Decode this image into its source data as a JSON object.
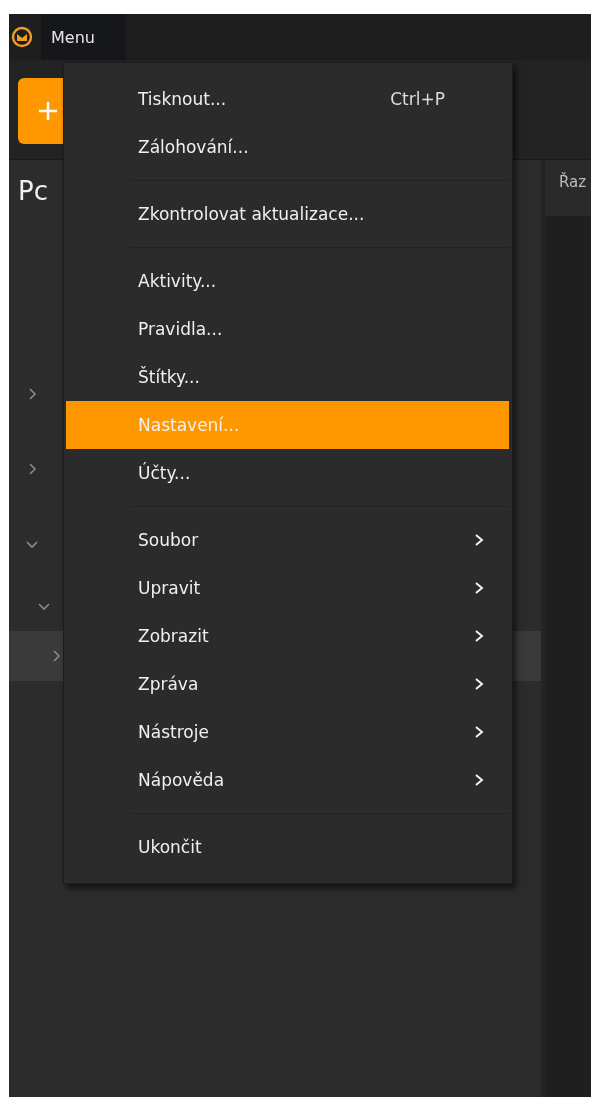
{
  "title_bar": {
    "menu_tab": "Menu"
  },
  "sidebar": {
    "title": "Pc",
    "tree": [
      {
        "expanded": false,
        "selected": false
      },
      {
        "expanded": false,
        "selected": false
      },
      {
        "expanded": true,
        "selected": false,
        "children": [
          {
            "expanded": true,
            "selected": false,
            "children": [
              {
                "expanded": false,
                "selected": true
              }
            ]
          }
        ]
      }
    ]
  },
  "message_pane": {
    "header": "Řaz"
  },
  "menu": {
    "groups": [
      [
        {
          "label": "Tisknout...",
          "shortcut": "Ctrl+P",
          "submenu": false,
          "selected": false
        },
        {
          "label": "Zálohování...",
          "submenu": false,
          "selected": false
        }
      ],
      [
        {
          "label": "Zkontrolovat aktualizace...",
          "submenu": false,
          "selected": false
        }
      ],
      [
        {
          "label": "Aktivity...",
          "submenu": false,
          "selected": false
        },
        {
          "label": "Pravidla...",
          "submenu": false,
          "selected": false
        },
        {
          "label": "Štítky...",
          "submenu": false,
          "selected": false
        },
        {
          "label": "Nastavení...",
          "submenu": false,
          "selected": true
        },
        {
          "label": "Účty...",
          "submenu": false,
          "selected": false
        }
      ],
      [
        {
          "label": "Soubor",
          "submenu": true,
          "selected": false
        },
        {
          "label": "Upravit",
          "submenu": true,
          "selected": false
        },
        {
          "label": "Zobrazit",
          "submenu": true,
          "selected": false
        },
        {
          "label": "Zpráva",
          "submenu": true,
          "selected": false
        },
        {
          "label": "Nástroje",
          "submenu": true,
          "selected": false
        },
        {
          "label": "Nápověda",
          "submenu": true,
          "selected": false
        }
      ],
      [
        {
          "label": "Ukončit",
          "submenu": false,
          "selected": false
        }
      ]
    ]
  }
}
